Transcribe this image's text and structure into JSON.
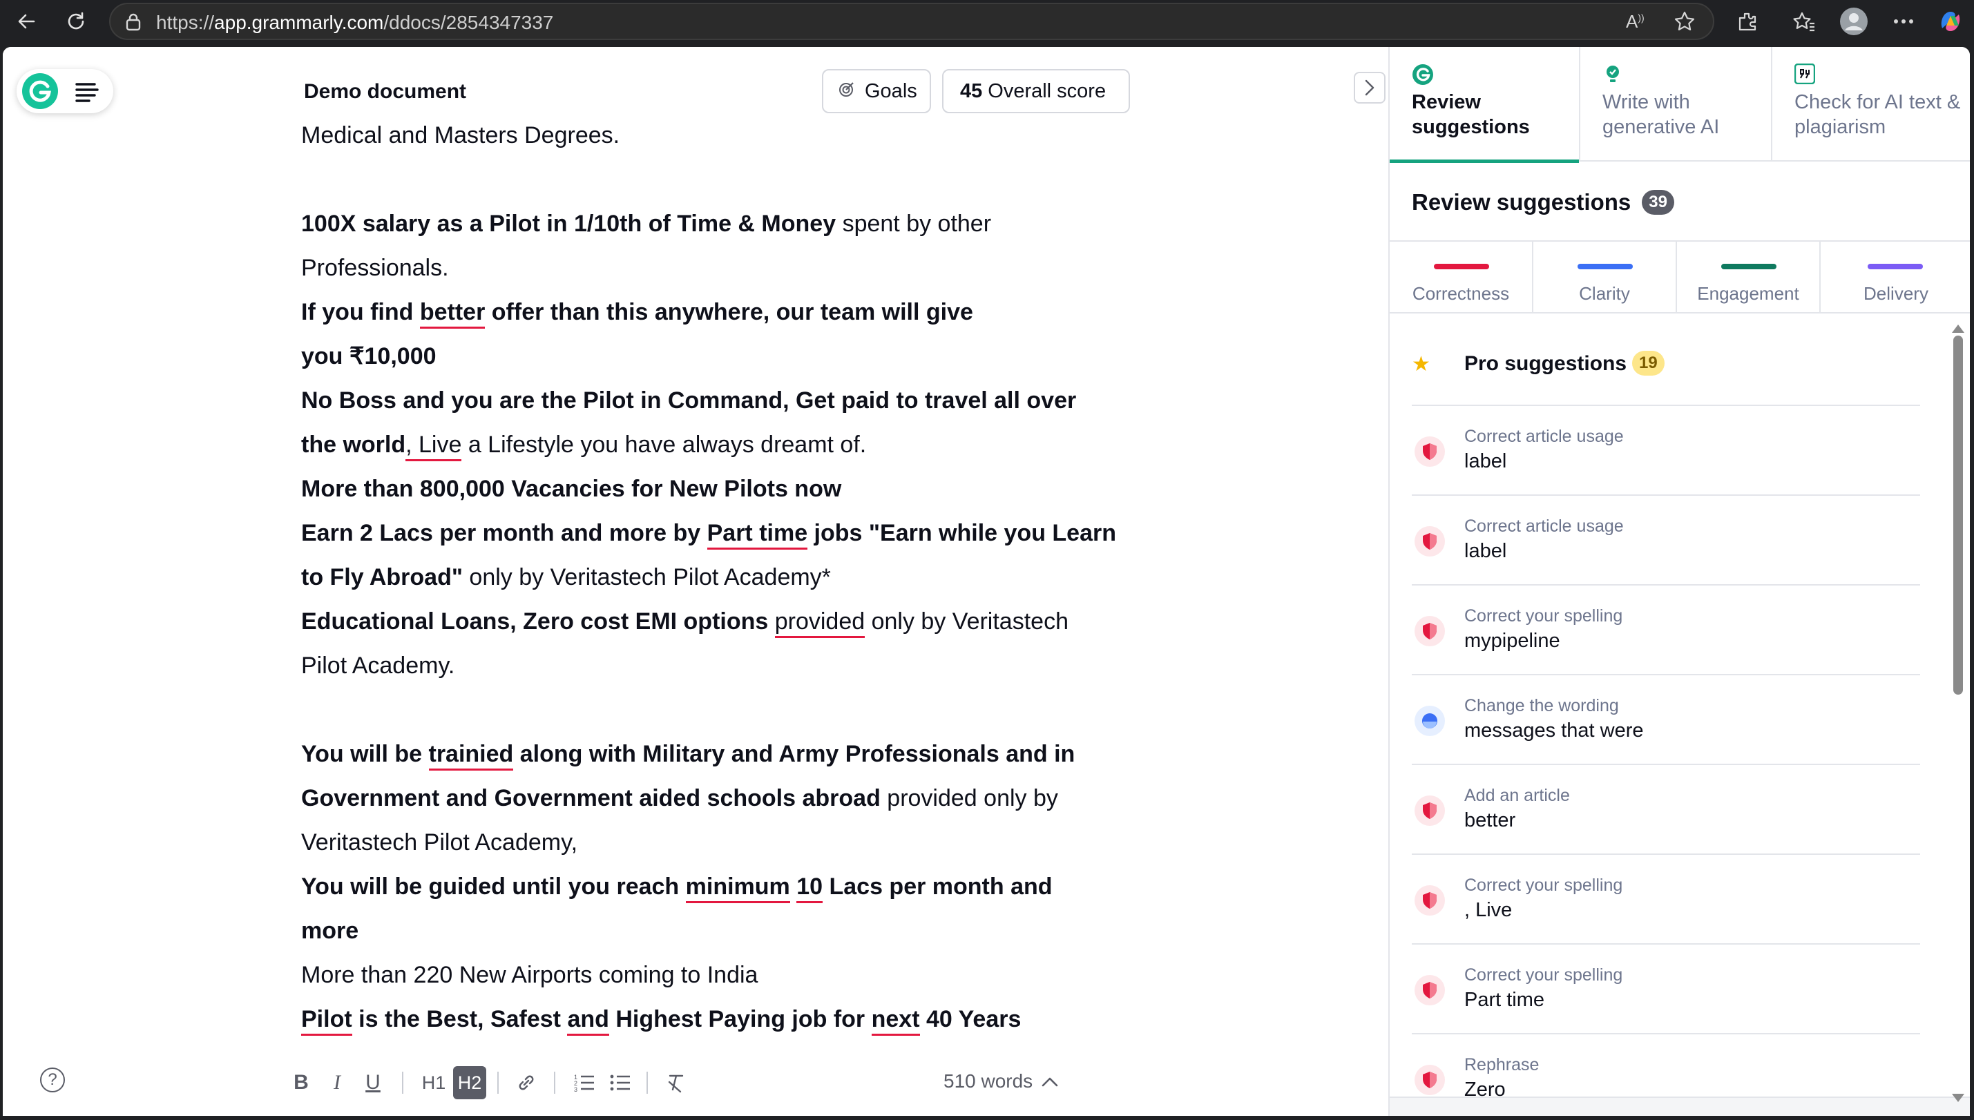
{
  "browser": {
    "url_prefix": "https://",
    "url_host": "app.grammarly.com",
    "url_path": "/ddocs/2854347337"
  },
  "editor": {
    "doc_title": "Demo document",
    "goals_label": "Goals",
    "score_value": "45",
    "score_label": "Overall score",
    "word_count": "510 words",
    "toolbar": {
      "bold": "B",
      "italic": "I",
      "underline": "U",
      "h1": "H1",
      "h2": "H2"
    },
    "lines": [
      "Medical and Masters Degrees.",
      "",
      "100X salary as a Pilot in 1/10th of Time & Money",
      " spent by other",
      "Professionals.",
      "If you find ",
      "better",
      " offer than this anywhere, our team will give",
      "you ₹10,000",
      "No Boss and you are the Pilot in Command, Get paid to travel all over",
      "the world",
      ", Live",
      " a Lifestyle you have always dreamt of.",
      "More than 800,000 Vacancies for New Pilots now",
      "Earn 2 Lacs per month and more by ",
      "Part time",
      " jobs \"Earn while you Learn",
      "to Fly Abroad\"",
      " only by Veritastech Pilot Academy*",
      "Educational Loans, Zero cost EMI options",
      " ",
      "provided",
      " only by Veritastech",
      "Pilot Academy.",
      "You will be ",
      "trainied",
      " along with Military and Army Professionals and in",
      "Government and Government aided schools abroad",
      " provided only by",
      "Veritastech Pilot Academy,",
      "You will be guided until you reach ",
      "minimum",
      " ",
      "10",
      " Lacs per month and",
      "more",
      "More than 220 New Airports coming to India",
      "Pilot",
      " is the Best, Safest ",
      "and",
      " Highest Paying job for ",
      "next",
      " 40 Years"
    ]
  },
  "panel": {
    "tabs": [
      {
        "label": "Review suggestions"
      },
      {
        "label": "Write with generative AI"
      },
      {
        "label": "Check for AI text & plagiarism"
      }
    ],
    "review_title": "Review suggestions",
    "review_count": "39",
    "categories": [
      {
        "label": "Correctness",
        "color": "#e3183f"
      },
      {
        "label": "Clarity",
        "color": "#3b6ff5"
      },
      {
        "label": "Engagement",
        "color": "#0f7a5f"
      },
      {
        "label": "Delivery",
        "color": "#7b5cf5"
      }
    ],
    "pro_label": "Pro suggestions",
    "pro_count": "19",
    "suggestions": [
      {
        "category": "Correct article usage",
        "value": "label",
        "kind": "correctness"
      },
      {
        "category": "Correct article usage",
        "value": "label",
        "kind": "correctness"
      },
      {
        "category": "Correct your spelling",
        "value": "mypipeline",
        "kind": "correctness"
      },
      {
        "category": "Change the wording",
        "value": "messages that were",
        "kind": "clarity"
      },
      {
        "category": "Add an article",
        "value": "better",
        "kind": "correctness"
      },
      {
        "category": "Correct your spelling",
        "value": ", Live",
        "kind": "correctness"
      },
      {
        "category": "Correct your spelling",
        "value": "Part time",
        "kind": "correctness"
      },
      {
        "category": "Rephrase",
        "value": "Zero",
        "kind": "correctness"
      }
    ]
  }
}
